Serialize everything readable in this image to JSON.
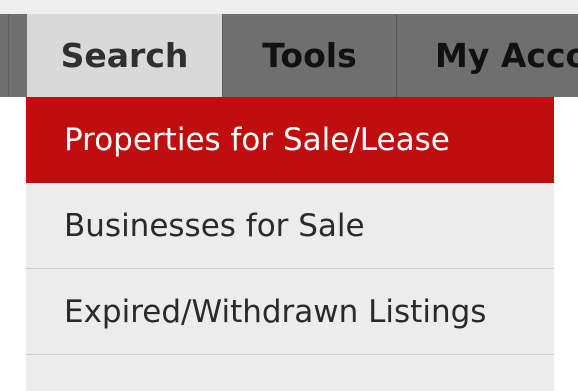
{
  "nav": {
    "tabs": [
      {
        "label": "Search",
        "state": "hover"
      },
      {
        "label": "Tools"
      },
      {
        "label": "My Acco"
      }
    ]
  },
  "dropdown": {
    "items": [
      {
        "label": "Properties for Sale/Lease",
        "state": "active"
      },
      {
        "label": "Businesses for Sale"
      },
      {
        "label": "Expired/Withdrawn Listings"
      }
    ]
  },
  "colors": {
    "nav_bg": "#6f6f6f",
    "active_tab_bg": "#d9d9d9",
    "menu_bg": "#ececec",
    "active_item_bg": "#c00d0d"
  }
}
